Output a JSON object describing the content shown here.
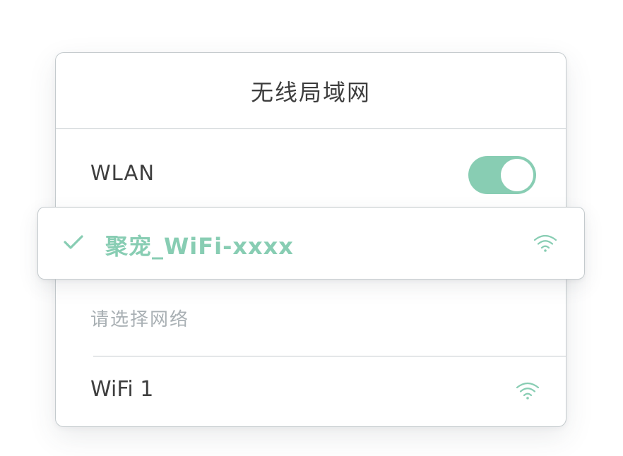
{
  "header": {
    "title": "无线局域网"
  },
  "wlan": {
    "label": "WLAN",
    "enabled": true
  },
  "connected_network": {
    "name": "聚宠_WiFi-xxxx",
    "status_icon": "check-icon",
    "signal_icon": "wifi-icon"
  },
  "network_list": {
    "section_label": "请选择网络",
    "items": [
      {
        "name": "WiFi 1",
        "signal_icon": "wifi-icon"
      }
    ]
  },
  "colors": {
    "accent": "#88cdb3",
    "text_primary": "#3e3e3e",
    "text_muted": "#a9b0b4",
    "border": "#c4cacd",
    "background": "#ffffff"
  }
}
